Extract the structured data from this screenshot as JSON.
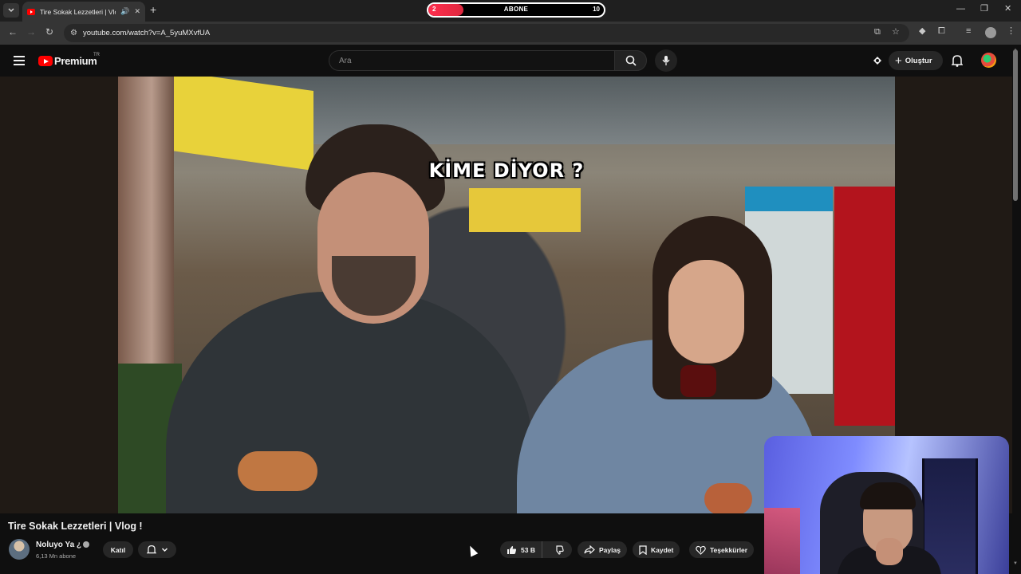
{
  "browser": {
    "tab": {
      "title": "Tire Sokak Lezzetleri | Vlog"
    },
    "subscriber_goal": {
      "current": "2",
      "label": "ABONE",
      "target": "10",
      "progress": 0.2
    },
    "url": "youtube.com/watch?v=A_5yuMXvfUA"
  },
  "youtube": {
    "brand": "Premium",
    "country": "TR",
    "search_placeholder": "Ara",
    "create_label": "Oluştur"
  },
  "video": {
    "caption": "KİME DİYOR ?",
    "title": "Tire Sokak Lezzetleri | Vlog !",
    "channel": {
      "name": "Noluyo Ya ¿",
      "subscribers": "6,13 Mn abone",
      "join_label": "Katıl"
    },
    "actions": {
      "likes": "53 B",
      "share": "Paylaş",
      "save": "Kaydet",
      "thanks": "Teşekkürler"
    }
  },
  "icons": {
    "tab_menu": "chevron-down-icon",
    "audio": "speaker-icon",
    "close": "close-icon",
    "search": "search-icon",
    "mic": "mic-icon",
    "bell": "bell-icon",
    "like": "thumbs-up-icon",
    "dislike": "thumbs-down-icon",
    "share": "share-arrow-icon",
    "save": "bookmark-icon",
    "thanks": "heart-dollar-icon"
  },
  "colors": {
    "youtube_red": "#ff0000",
    "goal_bar": "#ff2e4d",
    "background": "#0f0f0f"
  }
}
